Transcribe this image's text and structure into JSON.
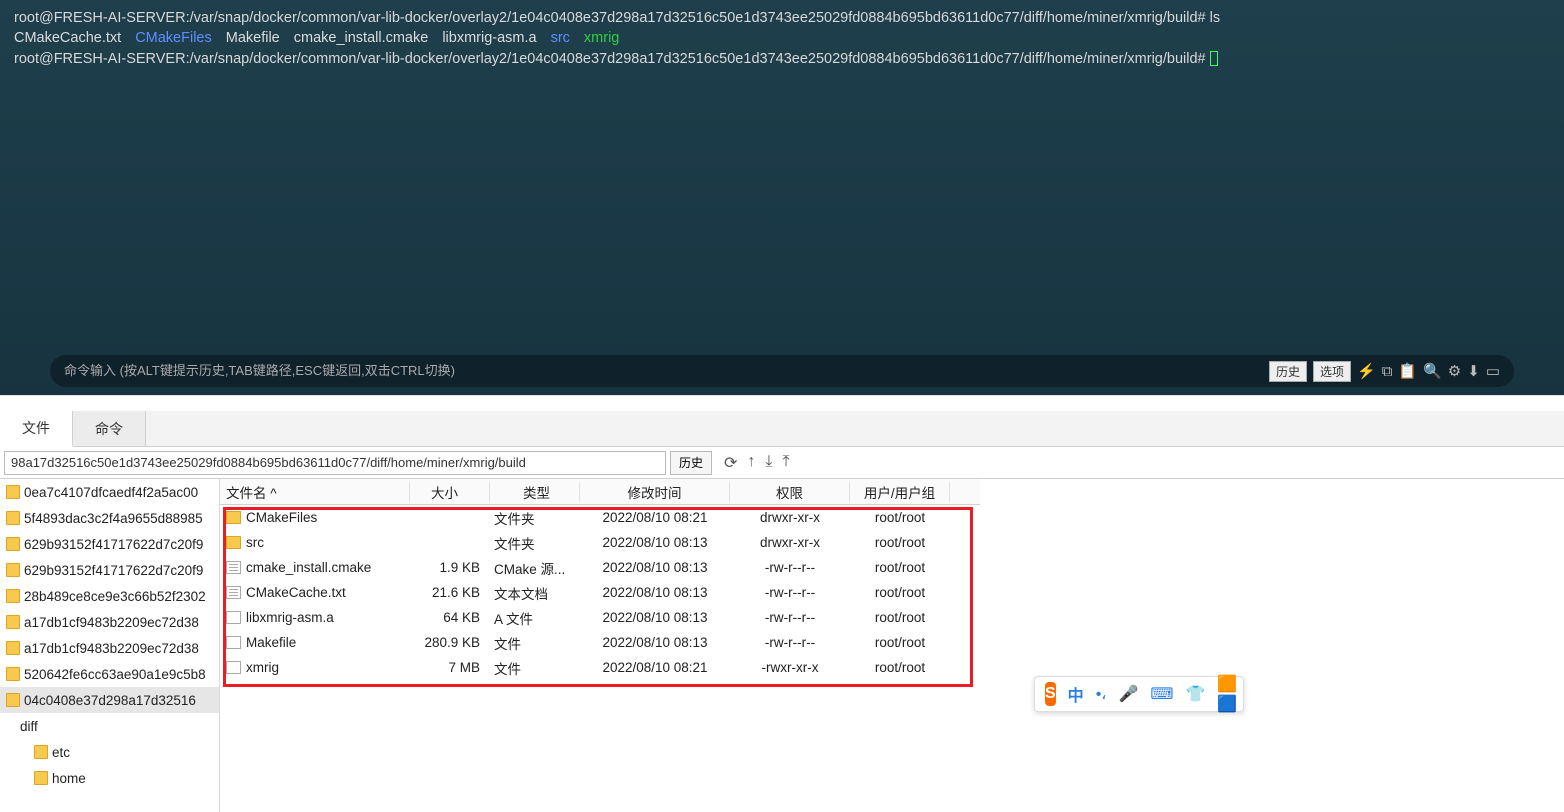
{
  "terminal": {
    "prompt": "root@FRESH-AI-SERVER:/var/snap/docker/common/var-lib-docker/overlay2/1e04c0408e37d298a17d32516c50e1d3743ee25029fd0884b695bd63611d0c77/diff/home/miner/xmrig/build#",
    "command": "ls",
    "items": [
      {
        "name": "CMakeCache.txt",
        "color": "white"
      },
      {
        "name": "CMakeFiles",
        "color": "blue"
      },
      {
        "name": "Makefile",
        "color": "white"
      },
      {
        "name": "cmake_install.cmake",
        "color": "white"
      },
      {
        "name": "libxmrig-asm.a",
        "color": "white"
      },
      {
        "name": "src",
        "color": "blue"
      },
      {
        "name": "xmrig",
        "color": "green"
      }
    ]
  },
  "cmdbar": {
    "placeholder": "命令输入 (按ALT键提示历史,TAB键路径,ESC键返回,双击CTRL切换)",
    "history_btn": "历史",
    "options_btn": "选项"
  },
  "tabs": {
    "file": "文件",
    "command": "命令"
  },
  "pathbar": {
    "value": "98a17d32516c50e1d3743ee25029fd0884b695bd63611d0c77/diff/home/miner/xmrig/build",
    "history": "历史"
  },
  "headers": {
    "name": "文件名 ^",
    "size": "大小",
    "type": "类型",
    "time": "修改时间",
    "perm": "权限",
    "user": "用户/用户组"
  },
  "files": [
    {
      "icon": "folder",
      "name": "CMakeFiles",
      "size": "",
      "type": "文件夹",
      "time": "2022/08/10 08:21",
      "perm": "drwxr-xr-x",
      "user": "root/root"
    },
    {
      "icon": "folder",
      "name": "src",
      "size": "",
      "type": "文件夹",
      "time": "2022/08/10 08:13",
      "perm": "drwxr-xr-x",
      "user": "root/root"
    },
    {
      "icon": "doc",
      "name": "cmake_install.cmake",
      "size": "1.9 KB",
      "type": "CMake 源...",
      "time": "2022/08/10 08:13",
      "perm": "-rw-r--r--",
      "user": "root/root"
    },
    {
      "icon": "doc",
      "name": "CMakeCache.txt",
      "size": "21.6 KB",
      "type": "文本文档",
      "time": "2022/08/10 08:13",
      "perm": "-rw-r--r--",
      "user": "root/root"
    },
    {
      "icon": "file",
      "name": "libxmrig-asm.a",
      "size": "64 KB",
      "type": "A 文件",
      "time": "2022/08/10 08:13",
      "perm": "-rw-r--r--",
      "user": "root/root"
    },
    {
      "icon": "file",
      "name": "Makefile",
      "size": "280.9 KB",
      "type": "文件",
      "time": "2022/08/10 08:13",
      "perm": "-rw-r--r--",
      "user": "root/root"
    },
    {
      "icon": "file",
      "name": "xmrig",
      "size": "7 MB",
      "type": "文件",
      "time": "2022/08/10 08:21",
      "perm": "-rwxr-xr-x",
      "user": "root/root"
    }
  ],
  "tree": [
    {
      "label": "0ea7c4107dfcaedf4f2a5ac00",
      "folder": true
    },
    {
      "label": "5f4893dac3c2f4a9655d88985",
      "folder": true
    },
    {
      "label": "629b93152f41717622d7c20f9",
      "folder": true
    },
    {
      "label": "629b93152f41717622d7c20f9",
      "folder": true
    },
    {
      "label": "28b489ce8ce9e3c66b52f2302",
      "folder": true
    },
    {
      "label": "a17db1cf9483b2209ec72d38",
      "folder": true
    },
    {
      "label": "a17db1cf9483b2209ec72d38",
      "folder": true
    },
    {
      "label": "520642fe6cc63ae90a1e9c5b8",
      "folder": true
    },
    {
      "label": "04c0408e37d298a17d32516",
      "folder": true,
      "sel": true
    },
    {
      "label": "diff",
      "folder": false,
      "indent": 1
    },
    {
      "label": "etc",
      "folder": true,
      "indent": 2
    },
    {
      "label": "home",
      "folder": true,
      "indent": 2
    }
  ],
  "ime": {
    "letter": "S",
    "zh": "中"
  }
}
